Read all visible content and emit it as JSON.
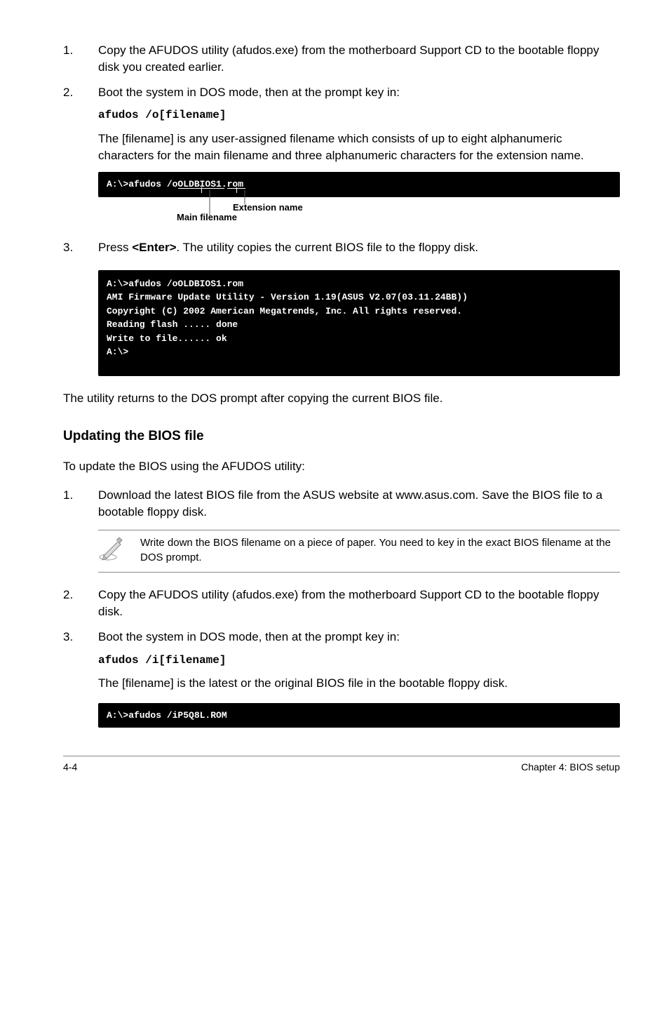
{
  "steps_a": {
    "1": "Copy the AFUDOS utility (afudos.exe) from the motherboard Support CD to the bootable floppy disk you created earlier.",
    "2": "Boot the system in DOS mode, then at the prompt key in:",
    "2_code": "afudos /o[filename]",
    "2_desc": "The [filename] is any user-assigned filename which consists of up to eight alphanumeric characters for the main filename and three alphanumeric characters for the extension name.",
    "3a": "Press ",
    "3b": "<Enter>",
    "3c": ". The utility copies the current BIOS file to the floppy disk."
  },
  "term1": {
    "line1": "A:\\>afudos /oOLDBIOS1.rom"
  },
  "anno": {
    "main": "Main filename",
    "ext": "Extension name"
  },
  "term2": {
    "l1": "A:\\>afudos /oOLDBIOS1.rom",
    "l2": "AMI Firmware Update Utility - Version 1.19(ASUS V2.07(03.11.24BB))",
    "l3": "Copyright (C) 2002 American Megatrends, Inc. All rights reserved.",
    "l4": "   Reading flash ..... done",
    "l5": "   Write to file...... ok",
    "l6": "A:\\>"
  },
  "after_term2": "The utility returns to the DOS prompt after copying the current BIOS file.",
  "heading": "Updating the BIOS file",
  "intro_b": "To update the BIOS using the AFUDOS utility:",
  "steps_b": {
    "1": "Download the latest BIOS file from the ASUS website at www.asus.com. Save the BIOS file to a bootable floppy disk.",
    "2": "Copy the AFUDOS utility (afudos.exe) from the motherboard Support CD to the bootable floppy disk.",
    "3": "Boot the system in DOS mode, then at the prompt key in:",
    "3_code": "afudos /i[filename]",
    "3_desc": "The [filename] is the latest or the original BIOS file in the bootable floppy disk."
  },
  "note": "Write down the BIOS filename on a piece of paper. You need to key in the exact BIOS filename at the DOS prompt.",
  "term3": {
    "line1": "A:\\>afudos /iP5Q8L.ROM"
  },
  "footer": {
    "left": "4-4",
    "right": "Chapter 4: BIOS setup"
  }
}
